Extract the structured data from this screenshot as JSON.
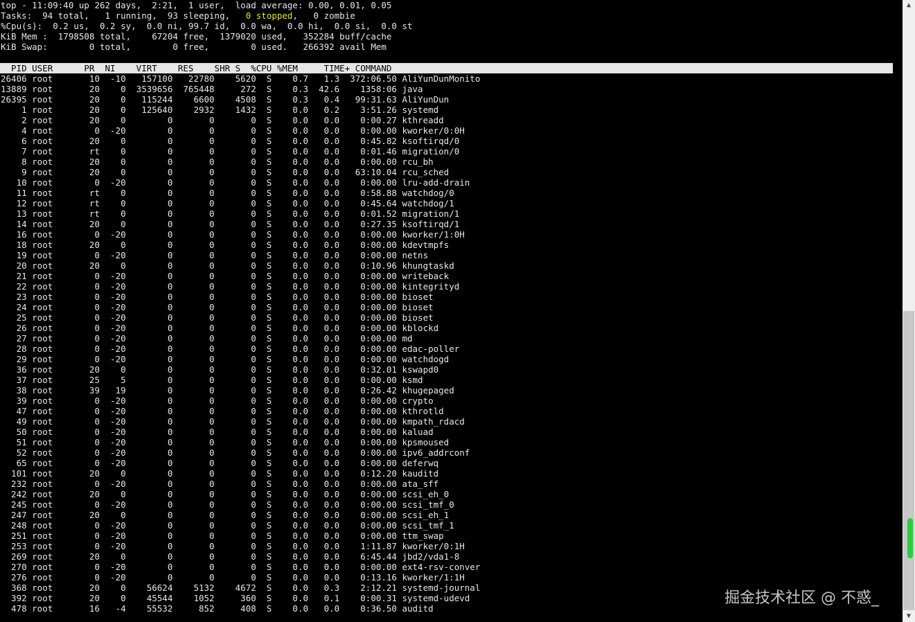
{
  "summary": {
    "line1": "top - 11:09:40 up 262 days,  2:21,  1 user,  load average: 0.00, 0.01, 0.05",
    "line2a": "Tasks:  94 total,   1 running,  93 sleeping,   ",
    "line2b": "0 stopped",
    "line2c": ",   0 zombie",
    "line3": "%Cpu(s):  0.2 us,  0.2 sy,  0.0 ni, 99.7 id,  0.0 wa,  0.0 hi,  0.0 si,  0.0 st",
    "line4": "KiB Mem :  1798508 total,    67204 free,  1379020 used,   352284 buff/cache",
    "line5": "KiB Swap:        0 total,        0 free,        0 used.   266392 avail Mem"
  },
  "header": "  PID USER      PR  NI    VIRT    RES    SHR S  %CPU %MEM     TIME+ COMMAND",
  "processes": [
    [
      "26406",
      "root",
      "10",
      "-10",
      "157100",
      "22780",
      "5620",
      "S",
      "0.7",
      "1.3",
      "372:06.50",
      "AliYunDunMonito"
    ],
    [
      "13889",
      "root",
      "20",
      "0",
      "3539656",
      "765448",
      "272",
      "S",
      "0.3",
      "42.6",
      "1358:06",
      "java"
    ],
    [
      "26395",
      "root",
      "20",
      "0",
      "115244",
      "6600",
      "4508",
      "S",
      "0.3",
      "0.4",
      "99:31.63",
      "AliYunDun"
    ],
    [
      "1",
      "root",
      "20",
      "0",
      "125640",
      "2932",
      "1432",
      "S",
      "0.0",
      "0.2",
      "3:51.26",
      "systemd"
    ],
    [
      "2",
      "root",
      "20",
      "0",
      "0",
      "0",
      "0",
      "S",
      "0.0",
      "0.0",
      "0:00.27",
      "kthreadd"
    ],
    [
      "4",
      "root",
      "0",
      "-20",
      "0",
      "0",
      "0",
      "S",
      "0.0",
      "0.0",
      "0:00.00",
      "kworker/0:0H"
    ],
    [
      "6",
      "root",
      "20",
      "0",
      "0",
      "0",
      "0",
      "S",
      "0.0",
      "0.0",
      "0:45.82",
      "ksoftirqd/0"
    ],
    [
      "7",
      "root",
      "rt",
      "0",
      "0",
      "0",
      "0",
      "S",
      "0.0",
      "0.0",
      "0:01.46",
      "migration/0"
    ],
    [
      "8",
      "root",
      "20",
      "0",
      "0",
      "0",
      "0",
      "S",
      "0.0",
      "0.0",
      "0:00.00",
      "rcu_bh"
    ],
    [
      "9",
      "root",
      "20",
      "0",
      "0",
      "0",
      "0",
      "S",
      "0.0",
      "0.0",
      "63:10.04",
      "rcu_sched"
    ],
    [
      "10",
      "root",
      "0",
      "-20",
      "0",
      "0",
      "0",
      "S",
      "0.0",
      "0.0",
      "0:00.00",
      "lru-add-drain"
    ],
    [
      "11",
      "root",
      "rt",
      "0",
      "0",
      "0",
      "0",
      "S",
      "0.0",
      "0.0",
      "0:58.88",
      "watchdog/0"
    ],
    [
      "12",
      "root",
      "rt",
      "0",
      "0",
      "0",
      "0",
      "S",
      "0.0",
      "0.0",
      "0:45.64",
      "watchdog/1"
    ],
    [
      "13",
      "root",
      "rt",
      "0",
      "0",
      "0",
      "0",
      "S",
      "0.0",
      "0.0",
      "0:01.52",
      "migration/1"
    ],
    [
      "14",
      "root",
      "20",
      "0",
      "0",
      "0",
      "0",
      "S",
      "0.0",
      "0.0",
      "0:27.35",
      "ksoftirqd/1"
    ],
    [
      "16",
      "root",
      "0",
      "-20",
      "0",
      "0",
      "0",
      "S",
      "0.0",
      "0.0",
      "0:00.00",
      "kworker/1:0H"
    ],
    [
      "18",
      "root",
      "20",
      "0",
      "0",
      "0",
      "0",
      "S",
      "0.0",
      "0.0",
      "0:00.00",
      "kdevtmpfs"
    ],
    [
      "19",
      "root",
      "0",
      "-20",
      "0",
      "0",
      "0",
      "S",
      "0.0",
      "0.0",
      "0:00.00",
      "netns"
    ],
    [
      "20",
      "root",
      "20",
      "0",
      "0",
      "0",
      "0",
      "S",
      "0.0",
      "0.0",
      "0:10.96",
      "khungtaskd"
    ],
    [
      "21",
      "root",
      "0",
      "-20",
      "0",
      "0",
      "0",
      "S",
      "0.0",
      "0.0",
      "0:00.00",
      "writeback"
    ],
    [
      "22",
      "root",
      "0",
      "-20",
      "0",
      "0",
      "0",
      "S",
      "0.0",
      "0.0",
      "0:00.00",
      "kintegrityd"
    ],
    [
      "23",
      "root",
      "0",
      "-20",
      "0",
      "0",
      "0",
      "S",
      "0.0",
      "0.0",
      "0:00.00",
      "bioset"
    ],
    [
      "24",
      "root",
      "0",
      "-20",
      "0",
      "0",
      "0",
      "S",
      "0.0",
      "0.0",
      "0:00.00",
      "bioset"
    ],
    [
      "25",
      "root",
      "0",
      "-20",
      "0",
      "0",
      "0",
      "S",
      "0.0",
      "0.0",
      "0:00.00",
      "bioset"
    ],
    [
      "26",
      "root",
      "0",
      "-20",
      "0",
      "0",
      "0",
      "S",
      "0.0",
      "0.0",
      "0:00.00",
      "kblockd"
    ],
    [
      "27",
      "root",
      "0",
      "-20",
      "0",
      "0",
      "0",
      "S",
      "0.0",
      "0.0",
      "0:00.00",
      "md"
    ],
    [
      "28",
      "root",
      "0",
      "-20",
      "0",
      "0",
      "0",
      "S",
      "0.0",
      "0.0",
      "0:00.00",
      "edac-poller"
    ],
    [
      "29",
      "root",
      "0",
      "-20",
      "0",
      "0",
      "0",
      "S",
      "0.0",
      "0.0",
      "0:00.00",
      "watchdogd"
    ],
    [
      "36",
      "root",
      "20",
      "0",
      "0",
      "0",
      "0",
      "S",
      "0.0",
      "0.0",
      "0:32.01",
      "kswapd0"
    ],
    [
      "37",
      "root",
      "25",
      "5",
      "0",
      "0",
      "0",
      "S",
      "0.0",
      "0.0",
      "0:00.00",
      "ksmd"
    ],
    [
      "38",
      "root",
      "39",
      "19",
      "0",
      "0",
      "0",
      "S",
      "0.0",
      "0.0",
      "0:26.42",
      "khugepaged"
    ],
    [
      "39",
      "root",
      "0",
      "-20",
      "0",
      "0",
      "0",
      "S",
      "0.0",
      "0.0",
      "0:00.00",
      "crypto"
    ],
    [
      "47",
      "root",
      "0",
      "-20",
      "0",
      "0",
      "0",
      "S",
      "0.0",
      "0.0",
      "0:00.00",
      "kthrotld"
    ],
    [
      "49",
      "root",
      "0",
      "-20",
      "0",
      "0",
      "0",
      "S",
      "0.0",
      "0.0",
      "0:00.00",
      "kmpath_rdacd"
    ],
    [
      "50",
      "root",
      "0",
      "-20",
      "0",
      "0",
      "0",
      "S",
      "0.0",
      "0.0",
      "0:00.00",
      "kaluad"
    ],
    [
      "51",
      "root",
      "0",
      "-20",
      "0",
      "0",
      "0",
      "S",
      "0.0",
      "0.0",
      "0:00.00",
      "kpsmoused"
    ],
    [
      "52",
      "root",
      "0",
      "-20",
      "0",
      "0",
      "0",
      "S",
      "0.0",
      "0.0",
      "0:00.00",
      "ipv6_addrconf"
    ],
    [
      "65",
      "root",
      "0",
      "-20",
      "0",
      "0",
      "0",
      "S",
      "0.0",
      "0.0",
      "0:00.00",
      "deferwq"
    ],
    [
      "101",
      "root",
      "20",
      "0",
      "0",
      "0",
      "0",
      "S",
      "0.0",
      "0.0",
      "0:12.20",
      "kauditd"
    ],
    [
      "232",
      "root",
      "0",
      "-20",
      "0",
      "0",
      "0",
      "S",
      "0.0",
      "0.0",
      "0:00.00",
      "ata_sff"
    ],
    [
      "242",
      "root",
      "20",
      "0",
      "0",
      "0",
      "0",
      "S",
      "0.0",
      "0.0",
      "0:00.00",
      "scsi_eh_0"
    ],
    [
      "245",
      "root",
      "0",
      "-20",
      "0",
      "0",
      "0",
      "S",
      "0.0",
      "0.0",
      "0:00.00",
      "scsi_tmf_0"
    ],
    [
      "247",
      "root",
      "20",
      "0",
      "0",
      "0",
      "0",
      "S",
      "0.0",
      "0.0",
      "0:00.00",
      "scsi_eh_1"
    ],
    [
      "248",
      "root",
      "0",
      "-20",
      "0",
      "0",
      "0",
      "S",
      "0.0",
      "0.0",
      "0:00.00",
      "scsi_tmf_1"
    ],
    [
      "251",
      "root",
      "0",
      "-20",
      "0",
      "0",
      "0",
      "S",
      "0.0",
      "0.0",
      "0:00.00",
      "ttm_swap"
    ],
    [
      "253",
      "root",
      "0",
      "-20",
      "0",
      "0",
      "0",
      "S",
      "0.0",
      "0.0",
      "1:11.87",
      "kworker/0:1H"
    ],
    [
      "269",
      "root",
      "20",
      "0",
      "0",
      "0",
      "0",
      "S",
      "0.0",
      "0.0",
      "6:45.44",
      "jbd2/vda1-8"
    ],
    [
      "270",
      "root",
      "0",
      "-20",
      "0",
      "0",
      "0",
      "S",
      "0.0",
      "0.0",
      "0:00.00",
      "ext4-rsv-conver"
    ],
    [
      "276",
      "root",
      "0",
      "-20",
      "0",
      "0",
      "0",
      "S",
      "0.0",
      "0.0",
      "0:13.16",
      "kworker/1:1H"
    ],
    [
      "368",
      "root",
      "20",
      "0",
      "56624",
      "5132",
      "4672",
      "S",
      "0.0",
      "0.3",
      "2:12.21",
      "systemd-journal"
    ],
    [
      "392",
      "root",
      "20",
      "0",
      "45544",
      "1052",
      "360",
      "S",
      "0.0",
      "0.1",
      "0:00.31",
      "systemd-udevd"
    ],
    [
      "478",
      "root",
      "16",
      "-4",
      "55532",
      "852",
      "408",
      "S",
      "0.0",
      "0.0",
      "0:36.50",
      "auditd"
    ]
  ],
  "watermark": "掘金技术社区 @ 不惑_",
  "colors": {
    "stopped": "#e6e62a",
    "header_bg": "#e6e6e6",
    "scroll_indicator": "#2ecc40"
  },
  "icons": {
    "scroll_up": "scroll-up-arrow-icon",
    "scroll_down": "scroll-down-arrow-icon"
  }
}
